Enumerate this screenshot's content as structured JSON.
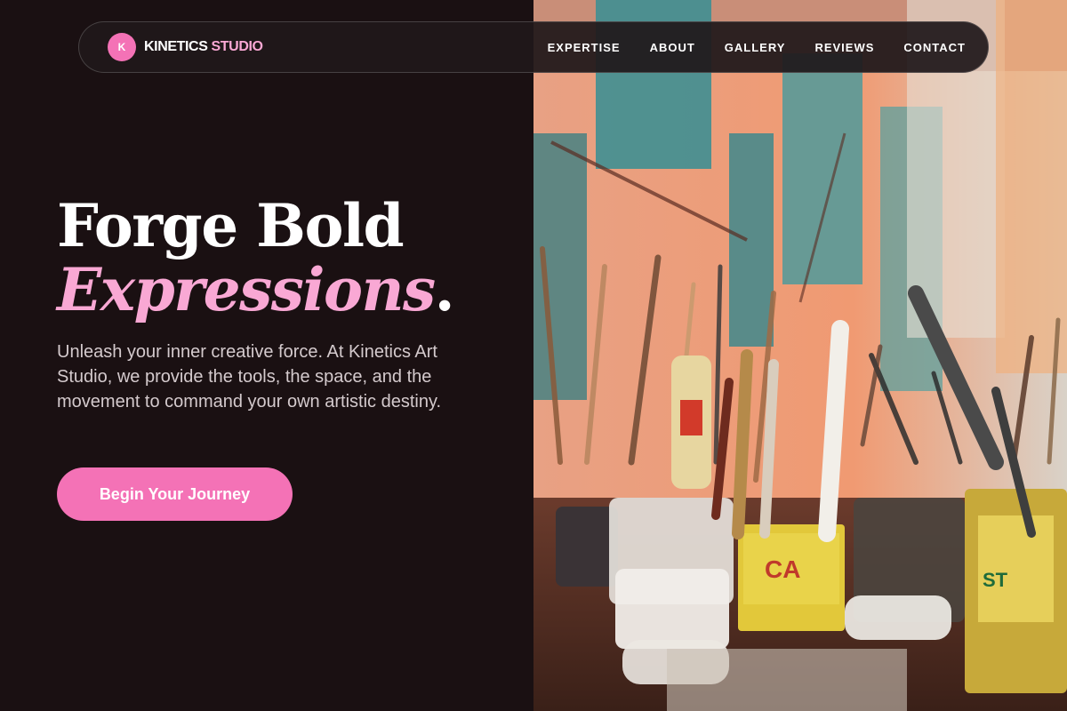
{
  "brand": {
    "badge": "K",
    "name_primary": "KINETICS",
    "name_accent": "STUDIO"
  },
  "nav": {
    "items": [
      "EXPERTISE",
      "ABOUT",
      "GALLERY",
      "REVIEWS",
      "CONTACT"
    ]
  },
  "hero": {
    "title_line1": "Forge Bold",
    "title_line2": "Expressions",
    "title_dot": ".",
    "subtitle": "Unleash your inner creative force. At Kinetics Art Studio, we provide the tools, the space, and the movement to command your own artistic destiny.",
    "cta_label": "Begin Your Journey"
  },
  "colors": {
    "accent": "#f472b6",
    "accent_light": "#f9a8d4",
    "background": "#1a1012"
  },
  "image": {
    "subject": "paint-brushes-in-jars-photo"
  }
}
